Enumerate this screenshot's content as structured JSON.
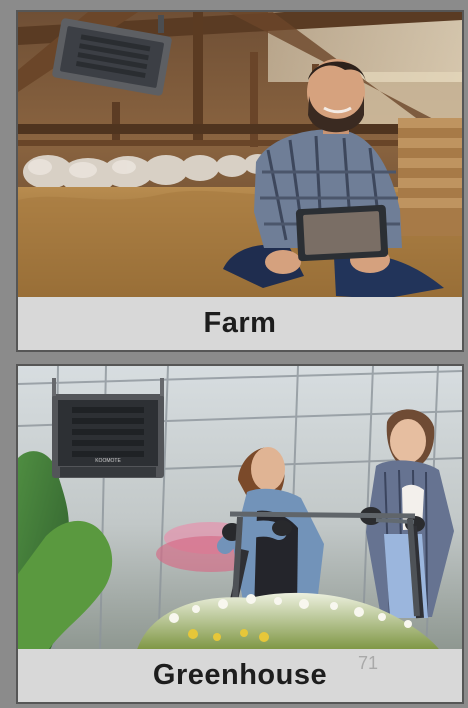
{
  "cards": [
    {
      "label": "Farm"
    },
    {
      "label": "Greenhouse",
      "page_number": "71"
    }
  ],
  "heater": {
    "brand_text": "KOOMOTE"
  },
  "colors": {
    "background": "#8b8b8b",
    "label_bar": "#d8d8d8",
    "label_text": "#1d1d1d"
  }
}
